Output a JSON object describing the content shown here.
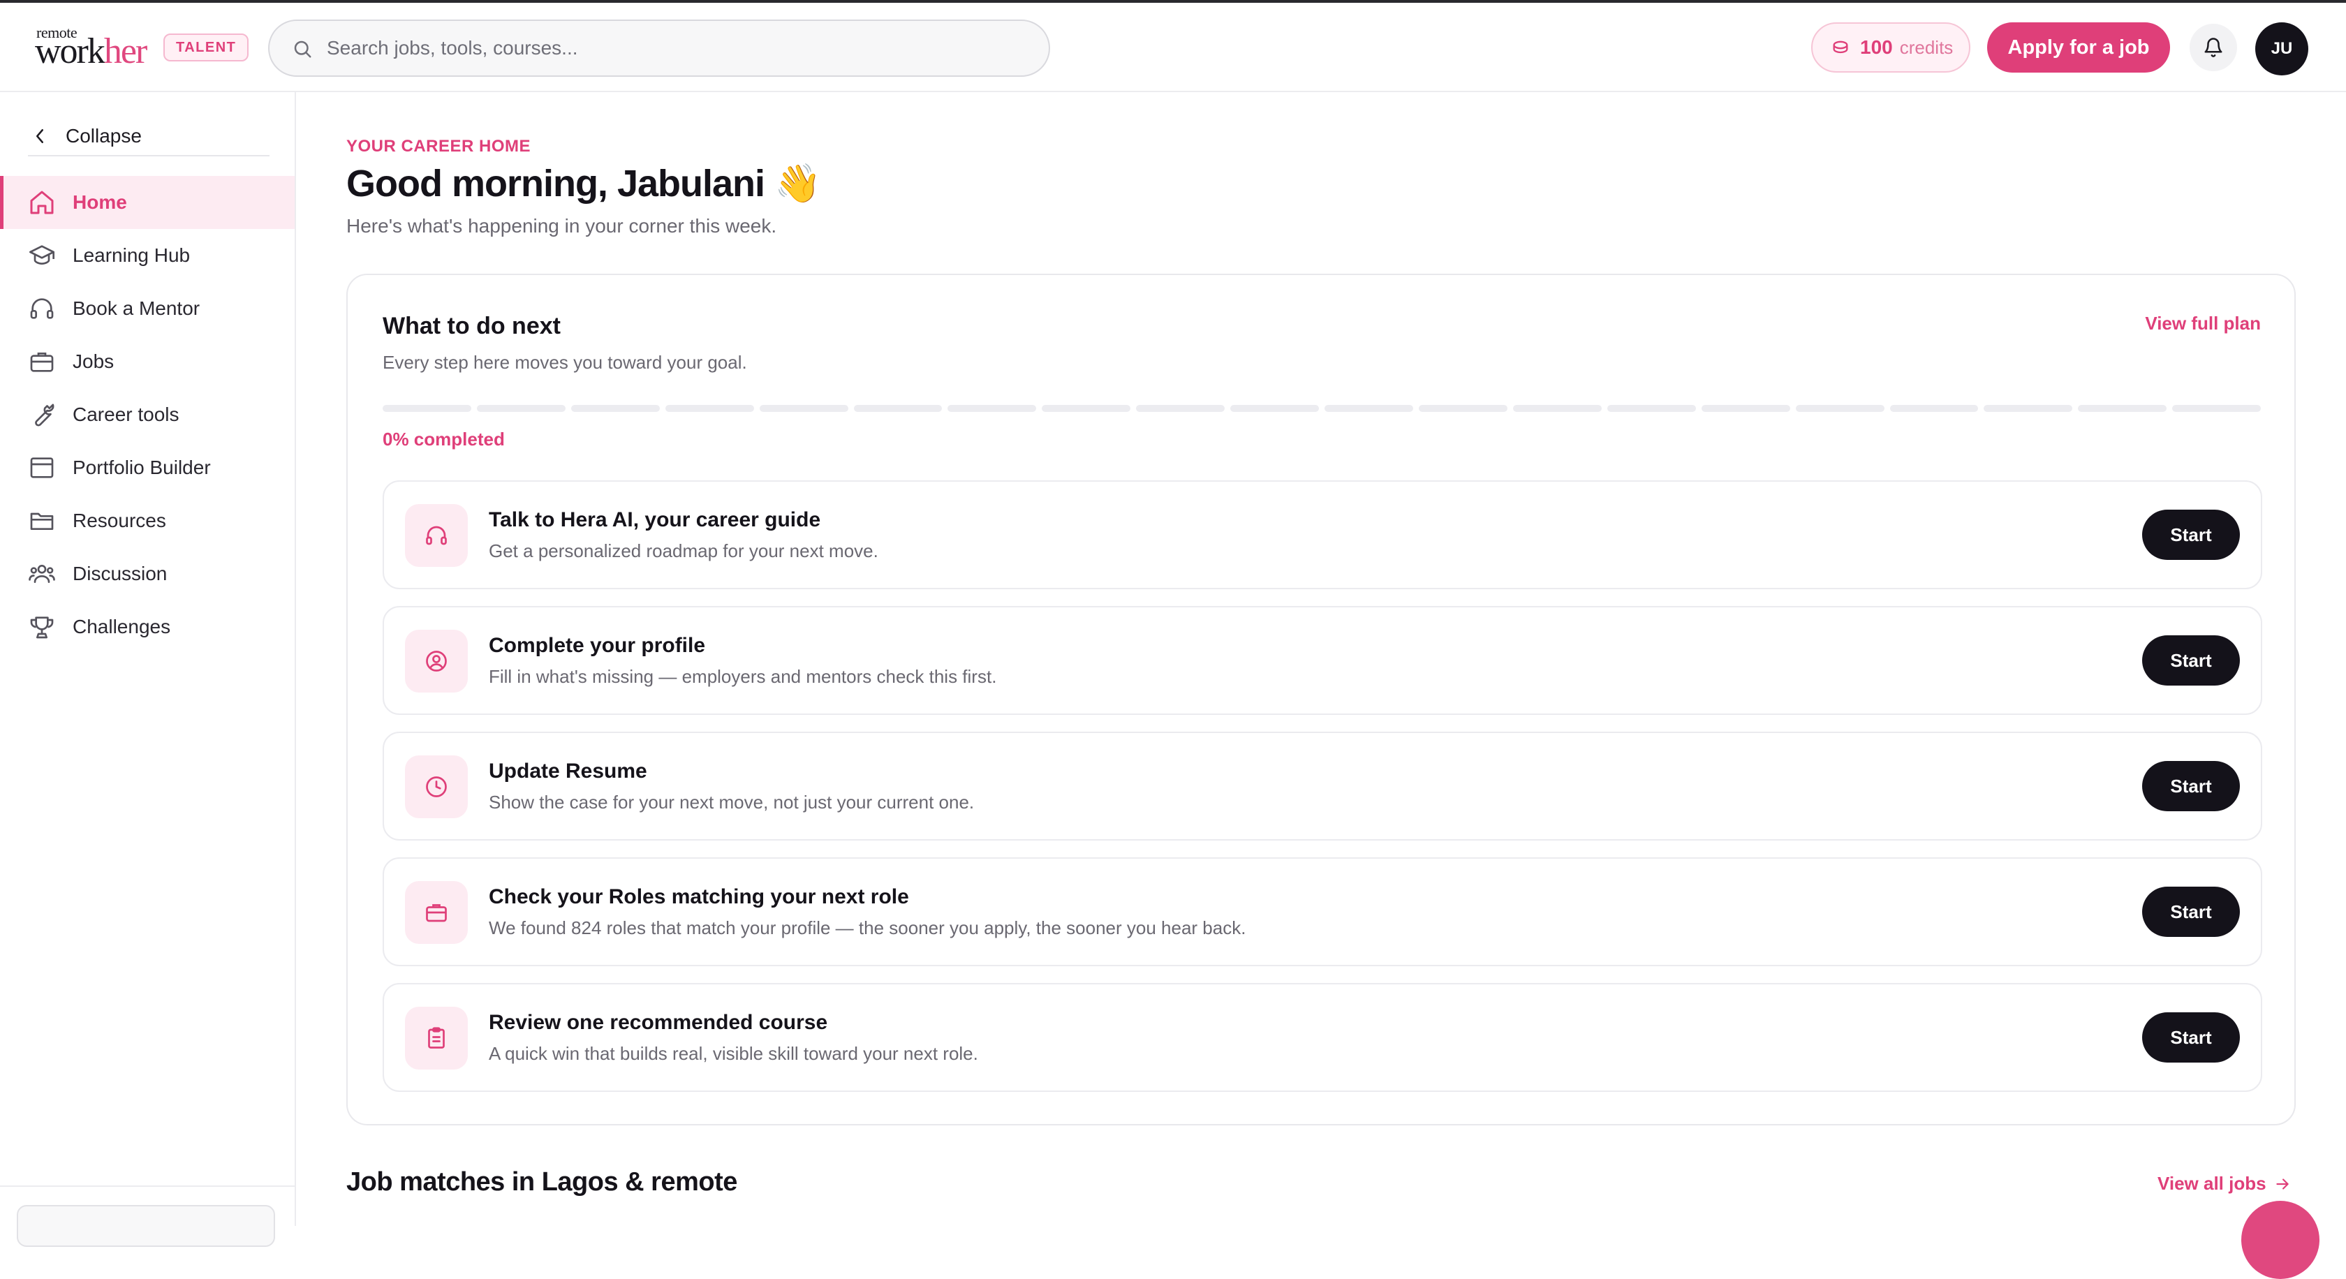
{
  "header": {
    "logo_small": "remote",
    "logo_main": "work",
    "logo_accent": "her",
    "badge": "TALENT",
    "search_placeholder": "Search jobs, tools, courses...",
    "credits_value": "100",
    "credits_label": "credits",
    "apply_label": "Apply for a job",
    "avatar_initials": "JU"
  },
  "sidebar": {
    "collapse_label": "Collapse",
    "items": [
      {
        "label": "Home",
        "icon": "home-icon",
        "active": true
      },
      {
        "label": "Learning Hub",
        "icon": "graduation-cap-icon",
        "active": false
      },
      {
        "label": "Book a Mentor",
        "icon": "headset-icon",
        "active": false
      },
      {
        "label": "Jobs",
        "icon": "briefcase-icon",
        "active": false
      },
      {
        "label": "Career tools",
        "icon": "wrench-icon",
        "active": false
      },
      {
        "label": "Portfolio Builder",
        "icon": "browser-window-icon",
        "active": false
      },
      {
        "label": "Resources",
        "icon": "folder-icon",
        "active": false
      },
      {
        "label": "Discussion",
        "icon": "users-icon",
        "active": false
      },
      {
        "label": "Challenges",
        "icon": "trophy-icon",
        "active": false
      }
    ]
  },
  "main": {
    "eyebrow": "YOUR CAREER HOME",
    "greeting": "Good morning, Jabulani 👋",
    "subtitle": "Here's what's happening in your corner this week.",
    "plan": {
      "title": "What to do next",
      "link": "View full plan",
      "subtitle": "Every step here moves you toward your goal.",
      "progress_percent": 0,
      "progress_segments": 20,
      "progress_label": "0% completed",
      "tasks": [
        {
          "title": "Talk to Hera AI, your career guide",
          "desc": "Get a personalized roadmap for your next move.",
          "icon": "headset-icon",
          "button": "Start"
        },
        {
          "title": "Complete your profile",
          "desc": "Fill in what's missing — employers and mentors check this first.",
          "icon": "user-circle-icon",
          "button": "Start"
        },
        {
          "title": "Update Resume",
          "desc": "Show the case for your next move, not just your current one.",
          "icon": "clock-icon",
          "button": "Start"
        },
        {
          "title": "Check your Roles matching your next role",
          "desc": "We found 824 roles that match your profile — the sooner you apply, the sooner you hear back.",
          "icon": "briefcase-icon",
          "button": "Start"
        },
        {
          "title": "Review one recommended course",
          "desc": "A quick win that builds real, visible skill toward your next role.",
          "icon": "clipboard-icon",
          "button": "Start"
        }
      ]
    },
    "jobs_section": {
      "title": "Job matches in Lagos & remote",
      "link": "View all jobs"
    }
  },
  "colors": {
    "accent": "#df3f79",
    "accent_soft": "#fdebf2",
    "dark": "#14121a",
    "muted": "#6a6871"
  }
}
